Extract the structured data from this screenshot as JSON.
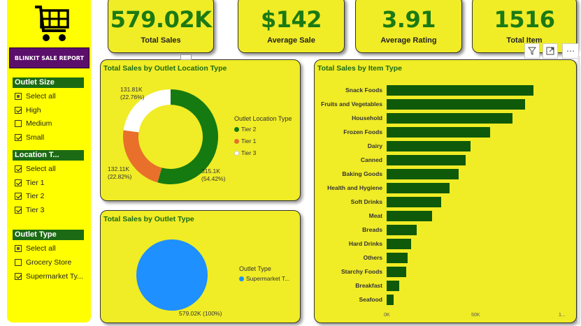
{
  "sidebar": {
    "report_title": "BLINKIT SALE REPORT",
    "outlet_size": {
      "header": "Outlet Size",
      "items": [
        {
          "label": "Select all",
          "state": "partial"
        },
        {
          "label": "High",
          "state": "checked"
        },
        {
          "label": "Medium",
          "state": "unchecked"
        },
        {
          "label": "Small",
          "state": "checked"
        }
      ]
    },
    "location_type": {
      "header": "Location T...",
      "items": [
        {
          "label": "Select all",
          "state": "checked"
        },
        {
          "label": "Tier 1",
          "state": "checked"
        },
        {
          "label": "Tier 2",
          "state": "checked"
        },
        {
          "label": "Tier 3",
          "state": "checked"
        }
      ]
    },
    "outlet_type": {
      "header": "Outlet Type",
      "items": [
        {
          "label": "Select all",
          "state": "partial"
        },
        {
          "label": "Grocery Store",
          "state": "unchecked"
        },
        {
          "label": "Supermarket Ty...",
          "state": "checked"
        }
      ]
    }
  },
  "kpis": [
    {
      "value": "579.02K",
      "label": "Total Sales"
    },
    {
      "value": "$142",
      "label": "Average Sale"
    },
    {
      "value": "3.91",
      "label": "Average Rating"
    },
    {
      "value": "1516",
      "label": "Total Item"
    }
  ],
  "toolbar": {
    "filter_icon": "filter-icon",
    "focus_icon": "focus-mode-icon",
    "more_icon": "more-options-icon",
    "more_label": "⋯"
  },
  "colors": {
    "accent_green": "#1b7a14",
    "panel_bg": "#f0ec26",
    "sidebar_bg": "#ffff00",
    "title_bg": "#5b0f6b",
    "tier2": "#157a10",
    "tier1": "#e8702a",
    "tier3": "#ffffff",
    "supermarket": "#1e90ff",
    "bar": "#0e5a0a"
  },
  "chart_data": [
    {
      "type": "pie",
      "donut": true,
      "title": "Total Sales by Outlet Location Type",
      "legend_title": "Outlet Location Type",
      "legend_position": "right",
      "slices": [
        {
          "name": "Tier 2",
          "value": 315.1,
          "value_label": "315.1K",
          "pct_label": "(54.42%)"
        },
        {
          "name": "Tier 1",
          "value": 132.11,
          "value_label": "132.11K",
          "pct_label": "(22.82%)"
        },
        {
          "name": "Tier 3",
          "value": 131.81,
          "value_label": "131.81K",
          "pct_label": "(22.76%)"
        }
      ]
    },
    {
      "type": "pie",
      "donut": false,
      "title": "Total Sales by Outlet Type",
      "legend_title": "Outlet Type",
      "legend_position": "right",
      "slices": [
        {
          "name": "Supermarket T...",
          "value": 579.02,
          "value_label": "579.02K (100%)"
        }
      ]
    },
    {
      "type": "bar",
      "orientation": "horizontal",
      "title": "Total Sales by Item Type",
      "categories": [
        "Snack Foods",
        "Fruits and Vegetables",
        "Household",
        "Frozen Foods",
        "Dairy",
        "Canned",
        "Baking Goods",
        "Health and Hygiene",
        "Soft Drinks",
        "Meat",
        "Breads",
        "Hard Drinks",
        "Others",
        "Starchy Foods",
        "Breakfast",
        "Seafood"
      ],
      "values": [
        84,
        79,
        72,
        59,
        48,
        45,
        41,
        36,
        31,
        26,
        17,
        14,
        12,
        11,
        7,
        4
      ],
      "xlim": [
        0,
        100
      ],
      "x_ticks": [
        "0K",
        "50K",
        "1..."
      ],
      "grid": false
    }
  ]
}
